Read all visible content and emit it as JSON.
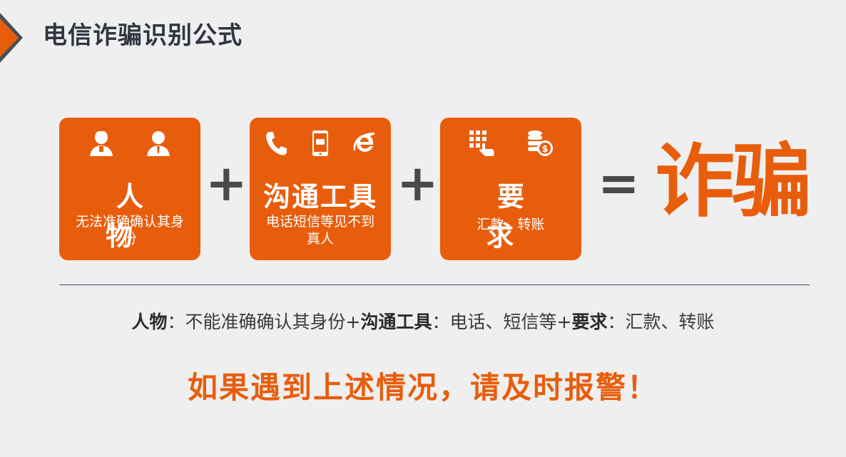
{
  "header": {
    "title": "电信诈骗识别公式"
  },
  "cards": [
    {
      "title": "人  物",
      "desc": "无法准确确认其身份",
      "icons": [
        "female-user-icon",
        "male-user-icon"
      ]
    },
    {
      "title": "沟通工具",
      "desc": "电话短信等见不到真人",
      "icons": [
        "phone-icon",
        "mobile-message-icon",
        "internet-icon"
      ]
    },
    {
      "title": "要  求",
      "desc": "汇款、转账",
      "icons": [
        "keypad-tap-icon",
        "coins-money-icon"
      ]
    }
  ],
  "formula": {
    "plus1": "+",
    "plus2": "+",
    "equals": "=",
    "result": "诈骗"
  },
  "summary": {
    "k1": "人物",
    "v1": "：不能准确确认其身份+",
    "k2": "沟通工具",
    "v2": "：电话、短信等+",
    "k3": "要求",
    "v3": "：汇款、转账"
  },
  "warning": "如果遇到上述情况，请及时报警！",
  "colors": {
    "accent": "#e85d0c",
    "dark": "#2f3640",
    "background": "#efefef"
  }
}
